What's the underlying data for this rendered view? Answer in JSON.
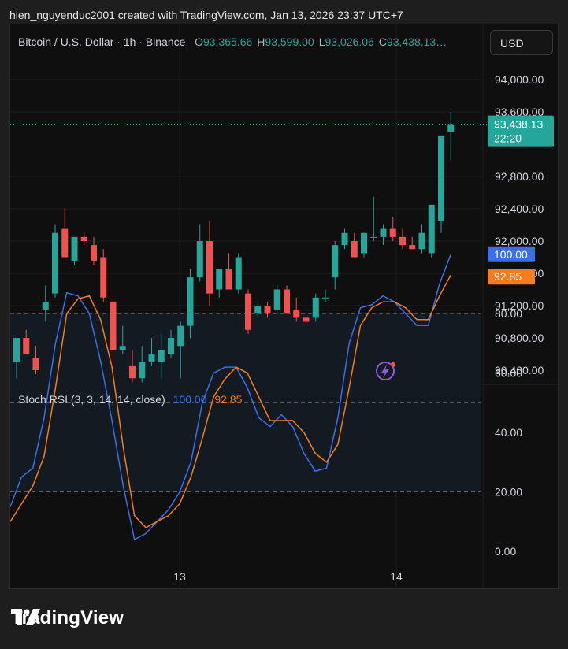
{
  "header": {
    "text": "hien_nguyenduc2001 created with TradingView.com, Jan 13, 2026 23:37 UTC+7"
  },
  "legend": {
    "symbol": "Bitcoin / U.S. Dollar · 1h · Binance",
    "o_label": "O",
    "o_value": "93,365.66",
    "h_label": "H",
    "h_value": "93,599.00",
    "l_label": "L",
    "l_value": "93,026.06",
    "c_label": "C",
    "c_value": "93,438.13…"
  },
  "currency_button": "USD",
  "price_badge": {
    "price": "93,438.13",
    "countdown": "22:20"
  },
  "stoch": {
    "label": "Stoch RSI (3, 3, 14, 14, close)",
    "k_value": "100.00",
    "d_value": "92.85"
  },
  "footer": {
    "brand": "TradingView"
  },
  "colors": {
    "up": "#26a69a",
    "down": "#ef5350",
    "k_line": "#3b6ee8",
    "d_line": "#f57c1f",
    "band": "#131a22"
  },
  "chart_data": [
    {
      "type": "candlestick",
      "title": "Bitcoin / U.S. Dollar · 1h · Binance",
      "ylim": [
        90200,
        94200
      ],
      "y_ticks": [
        "94,000.00",
        "93,600.00",
        "92,800.00",
        "92,400.00",
        "92,000.00",
        "91,600.00",
        "91,200.00",
        "90,800.00",
        "90,400.00"
      ],
      "y_tick_values": [
        94000,
        93600,
        92800,
        92400,
        92000,
        91600,
        91200,
        90800,
        90400
      ],
      "x_ticks": [
        "13",
        "14"
      ],
      "last_price": 93438.13,
      "candles": [
        {
          "o": 90500,
          "h": 90800,
          "l": 90300,
          "c": 90800
        },
        {
          "o": 90800,
          "h": 90900,
          "l": 90600,
          "c": 90600
        },
        {
          "o": 90550,
          "h": 90700,
          "l": 90350,
          "c": 90400
        },
        {
          "o": 91150,
          "h": 91450,
          "l": 91000,
          "c": 91250
        },
        {
          "o": 91350,
          "h": 92200,
          "l": 91300,
          "c": 92100
        },
        {
          "o": 92150,
          "h": 92400,
          "l": 91850,
          "c": 91800
        },
        {
          "o": 91750,
          "h": 92050,
          "l": 91700,
          "c": 92050
        },
        {
          "o": 92050,
          "h": 92100,
          "l": 91950,
          "c": 92000
        },
        {
          "o": 91950,
          "h": 92050,
          "l": 91700,
          "c": 91750
        },
        {
          "o": 91800,
          "h": 91900,
          "l": 91250,
          "c": 91300
        },
        {
          "o": 91250,
          "h": 91350,
          "l": 90450,
          "c": 90650
        },
        {
          "o": 90650,
          "h": 90950,
          "l": 90600,
          "c": 90700
        },
        {
          "o": 90450,
          "h": 90650,
          "l": 90250,
          "c": 90300
        },
        {
          "o": 90300,
          "h": 90700,
          "l": 90250,
          "c": 90500
        },
        {
          "o": 90500,
          "h": 90800,
          "l": 90450,
          "c": 90600
        },
        {
          "o": 90500,
          "h": 90850,
          "l": 90300,
          "c": 90650
        },
        {
          "o": 90600,
          "h": 90900,
          "l": 90550,
          "c": 90800
        },
        {
          "o": 90700,
          "h": 91000,
          "l": 90300,
          "c": 90950
        },
        {
          "o": 90950,
          "h": 91650,
          "l": 90800,
          "c": 91550
        },
        {
          "o": 91550,
          "h": 92200,
          "l": 91500,
          "c": 92000
        },
        {
          "o": 92000,
          "h": 92250,
          "l": 91200,
          "c": 91350
        },
        {
          "o": 91400,
          "h": 91650,
          "l": 91300,
          "c": 91650
        },
        {
          "o": 91650,
          "h": 91850,
          "l": 91400,
          "c": 91400
        },
        {
          "o": 91400,
          "h": 91850,
          "l": 91350,
          "c": 91800
        },
        {
          "o": 91350,
          "h": 91400,
          "l": 90850,
          "c": 90900
        },
        {
          "o": 91100,
          "h": 91250,
          "l": 91050,
          "c": 91200
        },
        {
          "o": 91200,
          "h": 91250,
          "l": 91050,
          "c": 91100
        },
        {
          "o": 91150,
          "h": 91450,
          "l": 91100,
          "c": 91400
        },
        {
          "o": 91400,
          "h": 91450,
          "l": 91100,
          "c": 91100
        },
        {
          "o": 91150,
          "h": 91300,
          "l": 91000,
          "c": 91050
        },
        {
          "o": 91050,
          "h": 91100,
          "l": 90950,
          "c": 91000
        },
        {
          "o": 91050,
          "h": 91350,
          "l": 91000,
          "c": 91300
        },
        {
          "o": 91300,
          "h": 91400,
          "l": 91250,
          "c": 91300
        },
        {
          "o": 91550,
          "h": 92000,
          "l": 91400,
          "c": 91950
        },
        {
          "o": 91950,
          "h": 92150,
          "l": 91900,
          "c": 92100
        },
        {
          "o": 92000,
          "h": 92100,
          "l": 91800,
          "c": 91800
        },
        {
          "o": 91850,
          "h": 92100,
          "l": 91800,
          "c": 92100
        },
        {
          "o": 92050,
          "h": 92550,
          "l": 92000,
          "c": 92050
        },
        {
          "o": 92050,
          "h": 92200,
          "l": 91950,
          "c": 92150
        },
        {
          "o": 92150,
          "h": 92300,
          "l": 92000,
          "c": 92050
        },
        {
          "o": 92050,
          "h": 92150,
          "l": 91900,
          "c": 91950
        },
        {
          "o": 91950,
          "h": 92050,
          "l": 91900,
          "c": 91900
        },
        {
          "o": 91900,
          "h": 92200,
          "l": 91850,
          "c": 92100
        },
        {
          "o": 91850,
          "h": 92450,
          "l": 91800,
          "c": 92450
        },
        {
          "o": 92250,
          "h": 92800,
          "l": 92100,
          "c": 93300
        },
        {
          "o": 93350,
          "h": 93600,
          "l": 93000,
          "c": 93438.13
        }
      ]
    },
    {
      "type": "line",
      "title": "Stoch RSI (3, 3, 14, 14, close)",
      "ylim": [
        -10,
        105
      ],
      "y_ticks": [
        "80.00",
        "60.00",
        "40.00",
        "20.00",
        "0.00"
      ],
      "y_tick_values": [
        80,
        60,
        40,
        20,
        0
      ],
      "bands": [
        20,
        50,
        80
      ],
      "series": [
        {
          "name": "K",
          "color": "#3b6ee8",
          "values": [
            15,
            25,
            28,
            45,
            70,
            87,
            86,
            80,
            64,
            44,
            22,
            4,
            6,
            10,
            14,
            20,
            30,
            50,
            60,
            62,
            62,
            55,
            45,
            42,
            46,
            42,
            33,
            27,
            28,
            45,
            70,
            82,
            83,
            86,
            84,
            80,
            76,
            76,
            90,
            100
          ]
        },
        {
          "name": "D",
          "color": "#f57c1f",
          "values": [
            10,
            16,
            22,
            32,
            55,
            80,
            85,
            86,
            78,
            62,
            35,
            12,
            8,
            10,
            12,
            16,
            25,
            38,
            52,
            58,
            62,
            60,
            52,
            44,
            44,
            44,
            40,
            33,
            30,
            36,
            55,
            76,
            82,
            84,
            84,
            82,
            78,
            78,
            86,
            93
          ]
        }
      ]
    }
  ]
}
